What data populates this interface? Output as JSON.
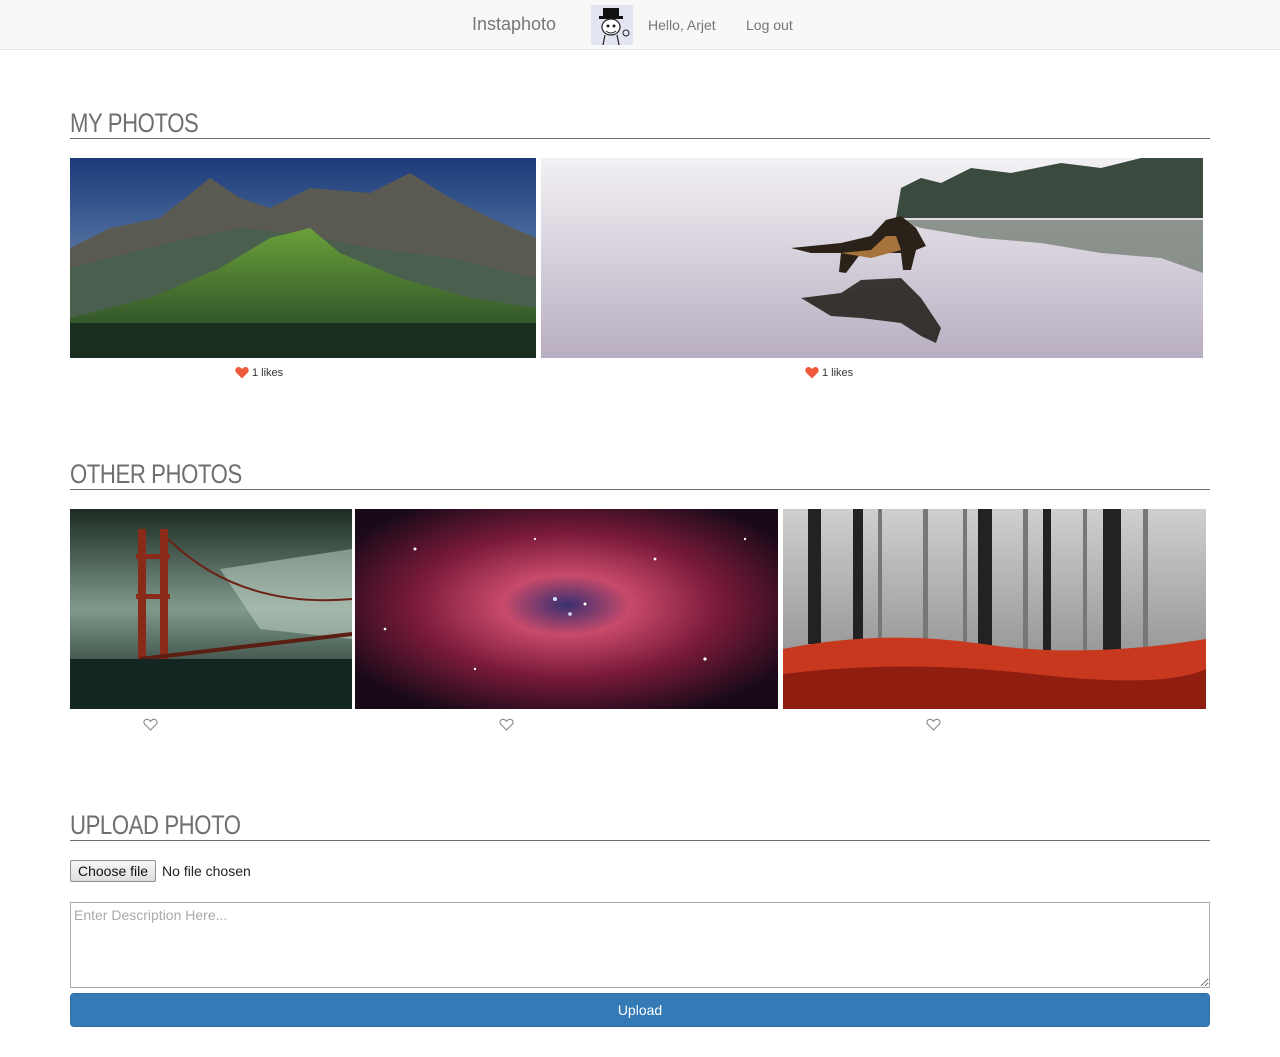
{
  "navbar": {
    "brand": "Instaphoto",
    "greeting": "Hello, Arjet",
    "logout_label": "Log out"
  },
  "my_photos": {
    "title": "MY PHOTOS",
    "photos": [
      {
        "subject": "mountain landscape",
        "likes_text": "1 likes",
        "liked": true
      },
      {
        "subject": "dog on lake reflection",
        "likes_text": "1 likes",
        "liked": true
      }
    ]
  },
  "other_photos": {
    "title": "OTHER PHOTOS",
    "photos": [
      {
        "subject": "golden gate bridge storm",
        "liked": false
      },
      {
        "subject": "rosette nebula",
        "liked": false
      },
      {
        "subject": "misty red forest",
        "liked": false
      }
    ]
  },
  "upload": {
    "title": "UPLOAD PHOTO",
    "choose_file_label": "Choose file",
    "file_status": "No file chosen",
    "description_placeholder": "Enter Description Here...",
    "upload_label": "Upload"
  },
  "colors": {
    "heart": "#f05a3c",
    "primary": "#337ab7",
    "navbar_bg": "#f8f8f8"
  }
}
